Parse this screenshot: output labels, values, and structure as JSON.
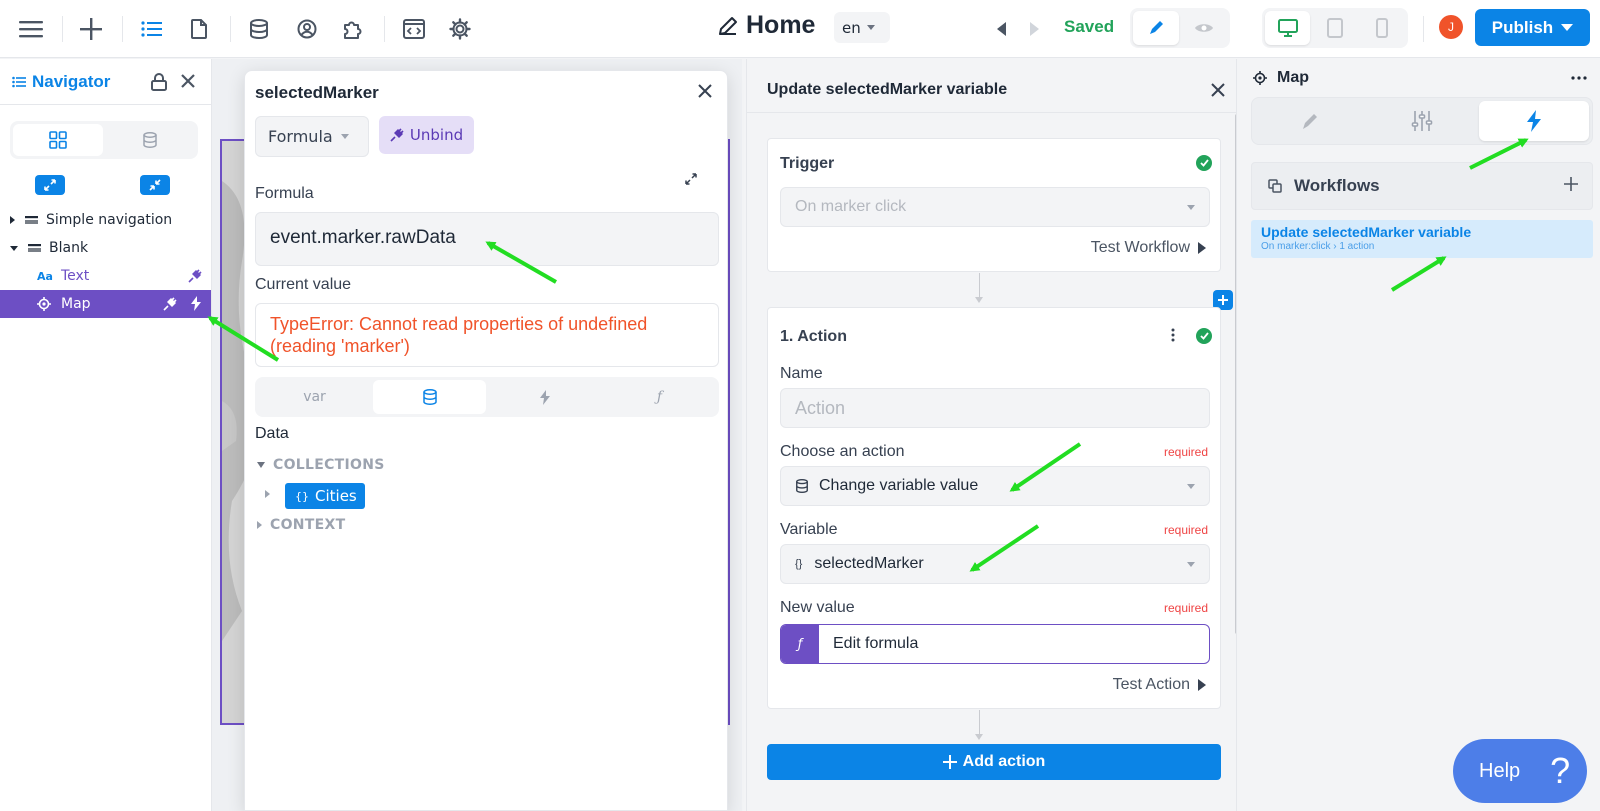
{
  "topbar": {
    "page_title": "Home",
    "language": "en",
    "status": "Saved",
    "avatar_initial": "J",
    "publish_label": "Publish"
  },
  "navigator": {
    "title": "Navigator",
    "tree": [
      {
        "label": "Simple navigation",
        "icon": "section-icon"
      },
      {
        "label": "Blank",
        "icon": "section-icon"
      },
      {
        "label": "Text",
        "icon": "text-icon"
      },
      {
        "label": "Map",
        "icon": "map-target-icon"
      }
    ]
  },
  "formula_popup": {
    "title": "selectedMarker",
    "mode_select": "Formula",
    "unbind_label": "Unbind",
    "formula_label": "Formula",
    "formula_value": "event.marker.rawData",
    "current_value_label": "Current value",
    "current_value": "TypeError: Cannot read properties of undefined (reading 'marker')",
    "tabs": [
      "var",
      "database-icon",
      "bolt-icon",
      "function-icon"
    ],
    "data_label": "Data",
    "collections_label": "COLLECTIONS",
    "collection_item": "Cities",
    "context_label": "CONTEXT"
  },
  "workflow_panel": {
    "title": "Update selectedMarker variable",
    "trigger": {
      "title": "Trigger",
      "value": "On marker click",
      "test_label": "Test Workflow"
    },
    "action": {
      "title": "1. Action",
      "name_label": "Name",
      "name_placeholder": "Action",
      "choose_label": "Choose an action",
      "choose_value": "Change variable value",
      "variable_label": "Variable",
      "variable_value": "selectedMarker",
      "new_value_label": "New value",
      "new_value": "Edit formula",
      "required_label": "required",
      "test_label": "Test Action"
    },
    "add_action_label": "Add action"
  },
  "right_panel": {
    "title": "Map",
    "workflows_label": "Workflows",
    "workflow_item": {
      "name": "Update selectedMarker variable",
      "subtitle": "On marker:click › 1 action"
    }
  },
  "help_label": "Help",
  "colors": {
    "primary": "#0b84e6",
    "purple": "#6d4fc4",
    "success": "#22a35a",
    "error": "#f0532a",
    "annotation_arrow": "#22dd22"
  }
}
